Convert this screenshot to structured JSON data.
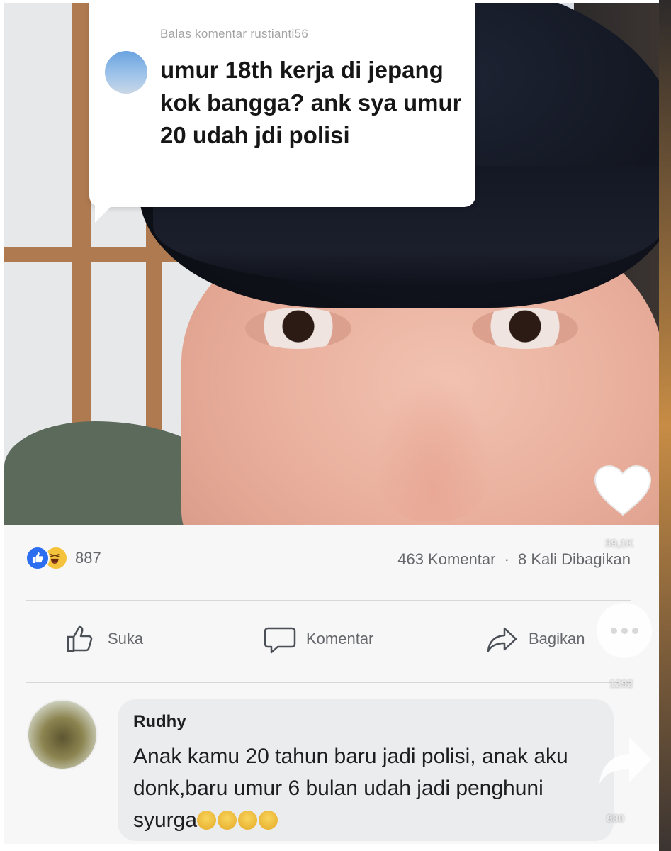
{
  "reply_card": {
    "header": "Balas komentar rustianti56",
    "text": "umur 18th kerja di jepang kok bangga? ank sya umur 20 udah jdi polisi"
  },
  "side_rail": {
    "likes_count": "39,1K",
    "comments_count": "1292",
    "shares_count": "830"
  },
  "post_stats": {
    "reaction_count": "887",
    "comments_label": "463 Komentar",
    "separator": "·",
    "shares_label": "8 Kali Dibagikan"
  },
  "actions": {
    "like_label": "Suka",
    "comment_label": "Komentar",
    "share_label": "Bagikan"
  },
  "comment": {
    "author": "Rudhy",
    "text": "Anak kamu 20 tahun baru jadi polisi, anak aku donk,baru umur 6 bulan udah jadi penghuni syurga",
    "emoji_count": 4,
    "emoji_name": "crying-face-emoji"
  },
  "colors": {
    "reaction_like": "#2d6ef0",
    "reaction_haha": "#f5c33b",
    "bubble_bg": "#ebecee",
    "muted_text": "#65676b"
  }
}
